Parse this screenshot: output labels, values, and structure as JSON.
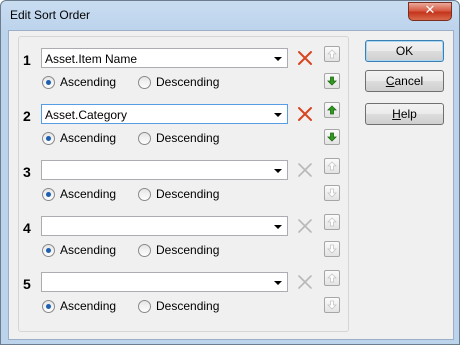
{
  "window": {
    "title": "Edit Sort Order",
    "close_glyph": "✕"
  },
  "rows": [
    {
      "number": "1",
      "value": "Asset.Item Name",
      "ascending": "Ascending",
      "descending": "Descending",
      "selected": "ascending",
      "has_value": true
    },
    {
      "number": "2",
      "value": "Asset.Category",
      "ascending": "Ascending",
      "descending": "Descending",
      "selected": "ascending",
      "has_value": true
    },
    {
      "number": "3",
      "value": "",
      "ascending": "Ascending",
      "descending": "Descending",
      "selected": "ascending",
      "has_value": false
    },
    {
      "number": "4",
      "value": "",
      "ascending": "Ascending",
      "descending": "Descending",
      "selected": "ascending",
      "has_value": false
    },
    {
      "number": "5",
      "value": "",
      "ascending": "Ascending",
      "descending": "Descending",
      "selected": "ascending",
      "has_value": false
    }
  ],
  "buttons": {
    "ok": "OK",
    "cancel_first": "C",
    "cancel_rest": "ancel",
    "help_first": "H",
    "help_rest": "elp"
  },
  "colors": {
    "remove_active": "#d9441e",
    "remove_inactive": "#b8b8b8",
    "move_active": "#2f9a1f",
    "move_inactive": "#c4c4c4"
  }
}
